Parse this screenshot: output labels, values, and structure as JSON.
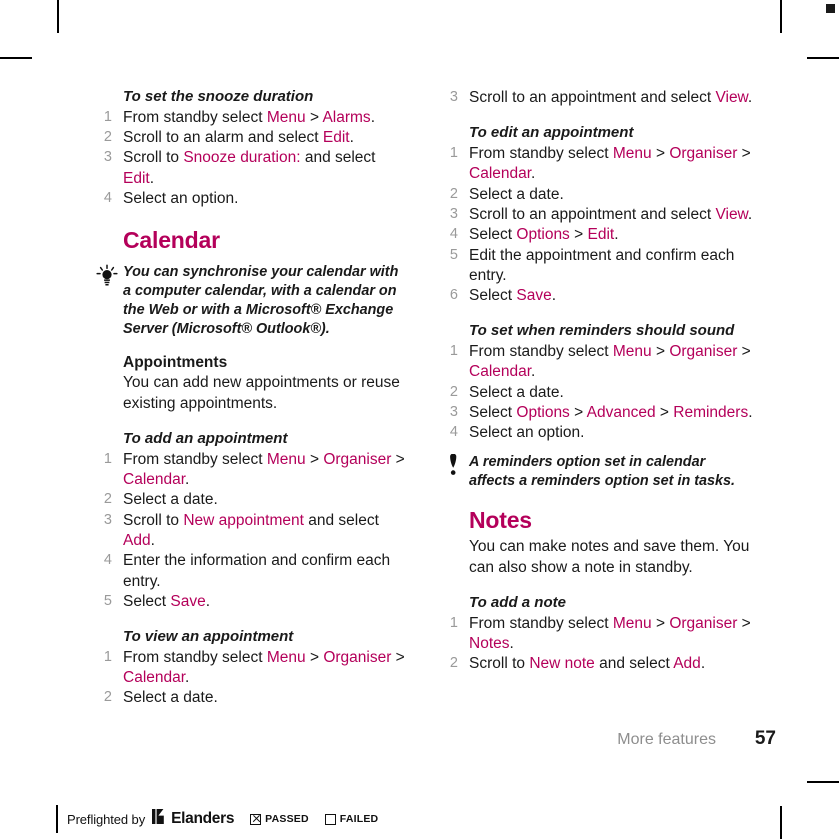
{
  "page": {
    "footer_label": "More features",
    "page_number": "57"
  },
  "left_column": {
    "proc_snooze": {
      "heading": "To set the snooze duration",
      "steps": [
        {
          "num": "1",
          "parts": [
            {
              "t": "From standby select ",
              "k": false
            },
            {
              "t": "Menu",
              "k": true
            },
            {
              "t": " > ",
              "k": false
            },
            {
              "t": "Alarms",
              "k": true
            },
            {
              "t": ".",
              "k": false
            }
          ]
        },
        {
          "num": "2",
          "parts": [
            {
              "t": "Scroll to an alarm and select ",
              "k": false
            },
            {
              "t": "Edit",
              "k": true
            },
            {
              "t": ".",
              "k": false
            }
          ]
        },
        {
          "num": "3",
          "parts": [
            {
              "t": "Scroll to ",
              "k": false
            },
            {
              "t": "Snooze duration:",
              "k": true
            },
            {
              "t": " and select ",
              "k": false
            },
            {
              "t": "Edit",
              "k": true
            },
            {
              "t": ".",
              "k": false
            }
          ]
        },
        {
          "num": "4",
          "parts": [
            {
              "t": "Select an option.",
              "k": false
            }
          ]
        }
      ]
    },
    "calendar_title": "Calendar",
    "tip_calendar": {
      "icon": "lightbulb-tip-icon",
      "text": "You can synchronise your calendar with a computer calendar, with a calendar on the Web or with a Microsoft® Exchange Server (Microsoft® Outlook®)."
    },
    "appointments_heading": "Appointments",
    "appointments_text": "You can add new appointments or reuse existing appointments.",
    "proc_add_appointment": {
      "heading": "To add an appointment",
      "steps": [
        {
          "num": "1",
          "parts": [
            {
              "t": "From standby select ",
              "k": false
            },
            {
              "t": "Menu",
              "k": true
            },
            {
              "t": " > ",
              "k": false
            },
            {
              "t": "Organiser",
              "k": true
            },
            {
              "t": " > ",
              "k": false
            },
            {
              "t": "Calendar",
              "k": true
            },
            {
              "t": ".",
              "k": false
            }
          ]
        },
        {
          "num": "2",
          "parts": [
            {
              "t": "Select a date.",
              "k": false
            }
          ]
        },
        {
          "num": "3",
          "parts": [
            {
              "t": "Scroll to ",
              "k": false
            },
            {
              "t": "New appointment",
              "k": true
            },
            {
              "t": " and select ",
              "k": false
            },
            {
              "t": "Add",
              "k": true
            },
            {
              "t": ".",
              "k": false
            }
          ]
        },
        {
          "num": "4",
          "parts": [
            {
              "t": "Enter the information and confirm each entry.",
              "k": false
            }
          ]
        },
        {
          "num": "5",
          "parts": [
            {
              "t": "Select ",
              "k": false
            },
            {
              "t": "Save",
              "k": true
            },
            {
              "t": ".",
              "k": false
            }
          ]
        }
      ]
    },
    "proc_view_appointment": {
      "heading": "To view an appointment",
      "steps": [
        {
          "num": "1",
          "parts": [
            {
              "t": "From standby select ",
              "k": false
            },
            {
              "t": "Menu",
              "k": true
            },
            {
              "t": " > ",
              "k": false
            },
            {
              "t": "Organiser",
              "k": true
            },
            {
              "t": " > ",
              "k": false
            },
            {
              "t": "Calendar",
              "k": true
            },
            {
              "t": ".",
              "k": false
            }
          ]
        },
        {
          "num": "2",
          "parts": [
            {
              "t": "Select a date.",
              "k": false
            }
          ]
        }
      ]
    }
  },
  "right_column": {
    "proc_view_continued": {
      "steps": [
        {
          "num": "3",
          "parts": [
            {
              "t": "Scroll to an appointment and select ",
              "k": false
            },
            {
              "t": "View",
              "k": true
            },
            {
              "t": ".",
              "k": false
            }
          ]
        }
      ]
    },
    "proc_edit_appointment": {
      "heading": "To edit an appointment",
      "steps": [
        {
          "num": "1",
          "parts": [
            {
              "t": "From standby select ",
              "k": false
            },
            {
              "t": "Menu",
              "k": true
            },
            {
              "t": " > ",
              "k": false
            },
            {
              "t": "Organiser",
              "k": true
            },
            {
              "t": " > ",
              "k": false
            },
            {
              "t": "Calendar",
              "k": true
            },
            {
              "t": ".",
              "k": false
            }
          ]
        },
        {
          "num": "2",
          "parts": [
            {
              "t": "Select a date.",
              "k": false
            }
          ]
        },
        {
          "num": "3",
          "parts": [
            {
              "t": "Scroll to an appointment and select ",
              "k": false
            },
            {
              "t": "View",
              "k": true
            },
            {
              "t": ".",
              "k": false
            }
          ]
        },
        {
          "num": "4",
          "parts": [
            {
              "t": "Select ",
              "k": false
            },
            {
              "t": "Options",
              "k": true
            },
            {
              "t": " > ",
              "k": false
            },
            {
              "t": "Edit",
              "k": true
            },
            {
              "t": ".",
              "k": false
            }
          ]
        },
        {
          "num": "5",
          "parts": [
            {
              "t": "Edit the appointment and confirm each entry.",
              "k": false
            }
          ]
        },
        {
          "num": "6",
          "parts": [
            {
              "t": "Select ",
              "k": false
            },
            {
              "t": "Save",
              "k": true
            },
            {
              "t": ".",
              "k": false
            }
          ]
        }
      ]
    },
    "proc_reminders": {
      "heading": "To set when reminders should sound",
      "steps": [
        {
          "num": "1",
          "parts": [
            {
              "t": "From standby select ",
              "k": false
            },
            {
              "t": "Menu",
              "k": true
            },
            {
              "t": " > ",
              "k": false
            },
            {
              "t": "Organiser",
              "k": true
            },
            {
              "t": " > ",
              "k": false
            },
            {
              "t": "Calendar",
              "k": true
            },
            {
              "t": ".",
              "k": false
            }
          ]
        },
        {
          "num": "2",
          "parts": [
            {
              "t": "Select a date.",
              "k": false
            }
          ]
        },
        {
          "num": "3",
          "parts": [
            {
              "t": "Select ",
              "k": false
            },
            {
              "t": "Options",
              "k": true
            },
            {
              "t": " > ",
              "k": false
            },
            {
              "t": "Advanced",
              "k": true
            },
            {
              "t": " > ",
              "k": false
            },
            {
              "t": "Reminders",
              "k": true
            },
            {
              "t": ".",
              "k": false
            }
          ]
        },
        {
          "num": "4",
          "parts": [
            {
              "t": "Select an option.",
              "k": false
            }
          ]
        }
      ]
    },
    "note_reminders": {
      "icon": "exclamation-note-icon",
      "text": "A reminders option set in calendar affects a reminders option set in tasks."
    },
    "notes_title": "Notes",
    "notes_text": "You can make notes and save them. You can also show a note in standby.",
    "proc_add_note": {
      "heading": "To add a note",
      "steps": [
        {
          "num": "1",
          "parts": [
            {
              "t": "From standby select ",
              "k": false
            },
            {
              "t": "Menu",
              "k": true
            },
            {
              "t": " > ",
              "k": false
            },
            {
              "t": "Organiser",
              "k": true
            },
            {
              "t": " > ",
              "k": false
            },
            {
              "t": "Notes",
              "k": true
            },
            {
              "t": ".",
              "k": false
            }
          ]
        },
        {
          "num": "2",
          "parts": [
            {
              "t": "Scroll to ",
              "k": false
            },
            {
              "t": "New note",
              "k": true
            },
            {
              "t": " and select ",
              "k": false
            },
            {
              "t": "Add",
              "k": true
            },
            {
              "t": ".",
              "k": false
            }
          ]
        }
      ]
    }
  },
  "preflight": {
    "prefix": "Preflighted by",
    "brand": "Elanders",
    "passed_label": "PASSED",
    "failed_label": "FAILED",
    "passed_checked": true,
    "failed_checked": false
  },
  "colors": {
    "accent": "#b4005a",
    "body": "#1a1a1a",
    "number": "#9a9a9a",
    "footer_label": "#8e8e8e"
  }
}
